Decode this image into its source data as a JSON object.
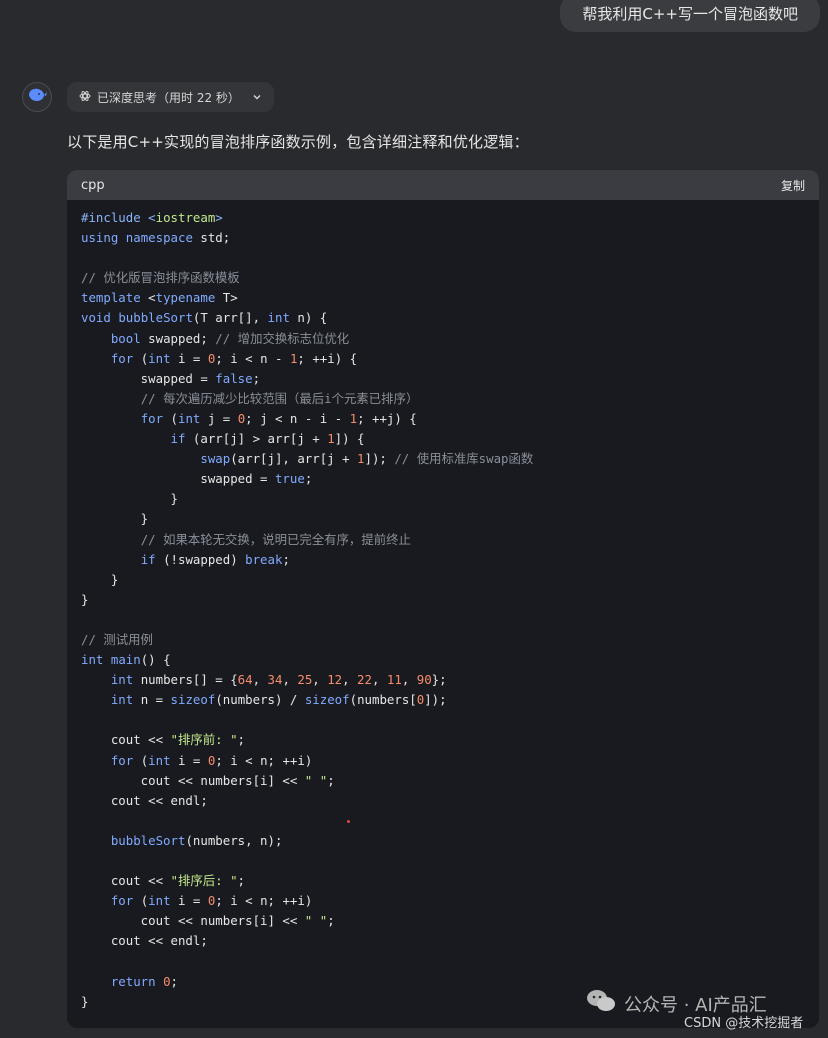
{
  "user_message": "帮我利用C++写一个冒泡函数吧",
  "assistant": {
    "think_label": "已深度思考（用时 22 秒）",
    "intro": "以下是用C++实现的冒泡排序函数示例，包含详细注释和优化逻辑："
  },
  "code_block": {
    "language": "cpp",
    "copy_label": "复制",
    "lines": [
      [
        [
          "#include <",
          "#8ab4f8"
        ],
        [
          "iostream",
          "#c3e88d"
        ],
        [
          ">",
          "#8ab4f8"
        ]
      ],
      [
        [
          "using",
          "#82aaff"
        ],
        [
          " ",
          "#ddd"
        ],
        [
          "namespace",
          "#82aaff"
        ],
        [
          " std;",
          "#e6e6e6"
        ]
      ],
      [],
      [
        [
          "// 优化版冒泡排序函数模板",
          "#8a8f98"
        ]
      ],
      [
        [
          "template",
          "#82aaff"
        ],
        [
          " <",
          "#e6e6e6"
        ],
        [
          "typename",
          "#82aaff"
        ],
        [
          " T>",
          "#e6e6e6"
        ]
      ],
      [
        [
          "void",
          "#82aaff"
        ],
        [
          " ",
          "#ddd"
        ],
        [
          "bubbleSort",
          "#82aaff"
        ],
        [
          "(T arr[], ",
          "#e6e6e6"
        ],
        [
          "int",
          "#82aaff"
        ],
        [
          " n) {",
          "#e6e6e6"
        ]
      ],
      [
        [
          "    ",
          "#ddd"
        ],
        [
          "bool",
          "#82aaff"
        ],
        [
          " swapped; ",
          "#e6e6e6"
        ],
        [
          "// 增加交换标志位优化",
          "#8a8f98"
        ]
      ],
      [
        [
          "    ",
          "#ddd"
        ],
        [
          "for",
          "#82aaff"
        ],
        [
          " (",
          "#e6e6e6"
        ],
        [
          "int",
          "#82aaff"
        ],
        [
          " i = ",
          "#e6e6e6"
        ],
        [
          "0",
          "#f78c6c"
        ],
        [
          "; i < n - ",
          "#e6e6e6"
        ],
        [
          "1",
          "#f78c6c"
        ],
        [
          "; ++i) {",
          "#e6e6e6"
        ]
      ],
      [
        [
          "        swapped = ",
          "#e6e6e6"
        ],
        [
          "false",
          "#82aaff"
        ],
        [
          ";",
          "#e6e6e6"
        ]
      ],
      [
        [
          "        ",
          "#ddd"
        ],
        [
          "// 每次遍历减少比较范围（最后i个元素已排序）",
          "#8a8f98"
        ]
      ],
      [
        [
          "        ",
          "#ddd"
        ],
        [
          "for",
          "#82aaff"
        ],
        [
          " (",
          "#e6e6e6"
        ],
        [
          "int",
          "#82aaff"
        ],
        [
          " j = ",
          "#e6e6e6"
        ],
        [
          "0",
          "#f78c6c"
        ],
        [
          "; j < n - i - ",
          "#e6e6e6"
        ],
        [
          "1",
          "#f78c6c"
        ],
        [
          "; ++j) {",
          "#e6e6e6"
        ]
      ],
      [
        [
          "            ",
          "#ddd"
        ],
        [
          "if",
          "#82aaff"
        ],
        [
          " (arr[j] > arr[j + ",
          "#e6e6e6"
        ],
        [
          "1",
          "#f78c6c"
        ],
        [
          "]) {",
          "#e6e6e6"
        ]
      ],
      [
        [
          "                ",
          "#ddd"
        ],
        [
          "swap",
          "#82aaff"
        ],
        [
          "(arr[j], arr[j + ",
          "#e6e6e6"
        ],
        [
          "1",
          "#f78c6c"
        ],
        [
          "]); ",
          "#e6e6e6"
        ],
        [
          "// 使用标准库swap函数",
          "#8a8f98"
        ]
      ],
      [
        [
          "                swapped = ",
          "#e6e6e6"
        ],
        [
          "true",
          "#82aaff"
        ],
        [
          ";",
          "#e6e6e6"
        ]
      ],
      [
        [
          "            }",
          "#e6e6e6"
        ]
      ],
      [
        [
          "        }",
          "#e6e6e6"
        ]
      ],
      [
        [
          "        ",
          "#ddd"
        ],
        [
          "// 如果本轮无交换，说明已完全有序，提前终止",
          "#8a8f98"
        ]
      ],
      [
        [
          "        ",
          "#ddd"
        ],
        [
          "if",
          "#82aaff"
        ],
        [
          " (!swapped) ",
          "#e6e6e6"
        ],
        [
          "break",
          "#82aaff"
        ],
        [
          ";",
          "#e6e6e6"
        ]
      ],
      [
        [
          "    }",
          "#e6e6e6"
        ]
      ],
      [
        [
          "}",
          "#e6e6e6"
        ]
      ],
      [],
      [
        [
          "// 测试用例",
          "#8a8f98"
        ]
      ],
      [
        [
          "int",
          "#82aaff"
        ],
        [
          " ",
          "#ddd"
        ],
        [
          "main",
          "#82aaff"
        ],
        [
          "() {",
          "#e6e6e6"
        ]
      ],
      [
        [
          "    ",
          "#ddd"
        ],
        [
          "int",
          "#82aaff"
        ],
        [
          " numbers[] = {",
          "#e6e6e6"
        ],
        [
          "64",
          "#f78c6c"
        ],
        [
          ", ",
          "#e6e6e6"
        ],
        [
          "34",
          "#f78c6c"
        ],
        [
          ", ",
          "#e6e6e6"
        ],
        [
          "25",
          "#f78c6c"
        ],
        [
          ", ",
          "#e6e6e6"
        ],
        [
          "12",
          "#f78c6c"
        ],
        [
          ", ",
          "#e6e6e6"
        ],
        [
          "22",
          "#f78c6c"
        ],
        [
          ", ",
          "#e6e6e6"
        ],
        [
          "11",
          "#f78c6c"
        ],
        [
          ", ",
          "#e6e6e6"
        ],
        [
          "90",
          "#f78c6c"
        ],
        [
          "};",
          "#e6e6e6"
        ]
      ],
      [
        [
          "    ",
          "#ddd"
        ],
        [
          "int",
          "#82aaff"
        ],
        [
          " n = ",
          "#e6e6e6"
        ],
        [
          "sizeof",
          "#82aaff"
        ],
        [
          "(numbers) / ",
          "#e6e6e6"
        ],
        [
          "sizeof",
          "#82aaff"
        ],
        [
          "(numbers[",
          "#e6e6e6"
        ],
        [
          "0",
          "#f78c6c"
        ],
        [
          "]);",
          "#e6e6e6"
        ]
      ],
      [],
      [
        [
          "    cout << ",
          "#e6e6e6"
        ],
        [
          "\"排序前: \"",
          "#c3e88d"
        ],
        [
          ";",
          "#e6e6e6"
        ]
      ],
      [
        [
          "    ",
          "#ddd"
        ],
        [
          "for",
          "#82aaff"
        ],
        [
          " (",
          "#e6e6e6"
        ],
        [
          "int",
          "#82aaff"
        ],
        [
          " i = ",
          "#e6e6e6"
        ],
        [
          "0",
          "#f78c6c"
        ],
        [
          "; i < n; ++i)",
          "#e6e6e6"
        ]
      ],
      [
        [
          "        cout << numbers[i] << ",
          "#e6e6e6"
        ],
        [
          "\" \"",
          "#c3e88d"
        ],
        [
          ";",
          "#e6e6e6"
        ]
      ],
      [
        [
          "    cout << endl;",
          "#e6e6e6"
        ]
      ],
      [],
      [
        [
          "    ",
          "#ddd"
        ],
        [
          "bubbleSort",
          "#82aaff"
        ],
        [
          "(numbers, n);",
          "#e6e6e6"
        ]
      ],
      [],
      [
        [
          "    cout << ",
          "#e6e6e6"
        ],
        [
          "\"排序后: \"",
          "#c3e88d"
        ],
        [
          ";",
          "#e6e6e6"
        ]
      ],
      [
        [
          "    ",
          "#ddd"
        ],
        [
          "for",
          "#82aaff"
        ],
        [
          " (",
          "#e6e6e6"
        ],
        [
          "int",
          "#82aaff"
        ],
        [
          " i = ",
          "#e6e6e6"
        ],
        [
          "0",
          "#f78c6c"
        ],
        [
          "; i < n; ++i)",
          "#e6e6e6"
        ]
      ],
      [
        [
          "        cout << numbers[i] << ",
          "#e6e6e6"
        ],
        [
          "\" \"",
          "#c3e88d"
        ],
        [
          ";",
          "#e6e6e6"
        ]
      ],
      [
        [
          "    cout << endl;",
          "#e6e6e6"
        ]
      ],
      [],
      [
        [
          "    ",
          "#ddd"
        ],
        [
          "return",
          "#82aaff"
        ],
        [
          " ",
          "#ddd"
        ],
        [
          "0",
          "#f78c6c"
        ],
        [
          ";",
          "#e6e6e6"
        ]
      ],
      [
        [
          "}",
          "#e6e6e6"
        ]
      ]
    ]
  },
  "watermark": {
    "text": "公众号 · AI产品汇",
    "credit": "CSDN @技术挖掘者"
  },
  "icons": {
    "avatar": "deepseek-whale-icon",
    "think": "atom-icon",
    "chevron": "chevron-down-icon",
    "wechat": "wechat-icon"
  }
}
